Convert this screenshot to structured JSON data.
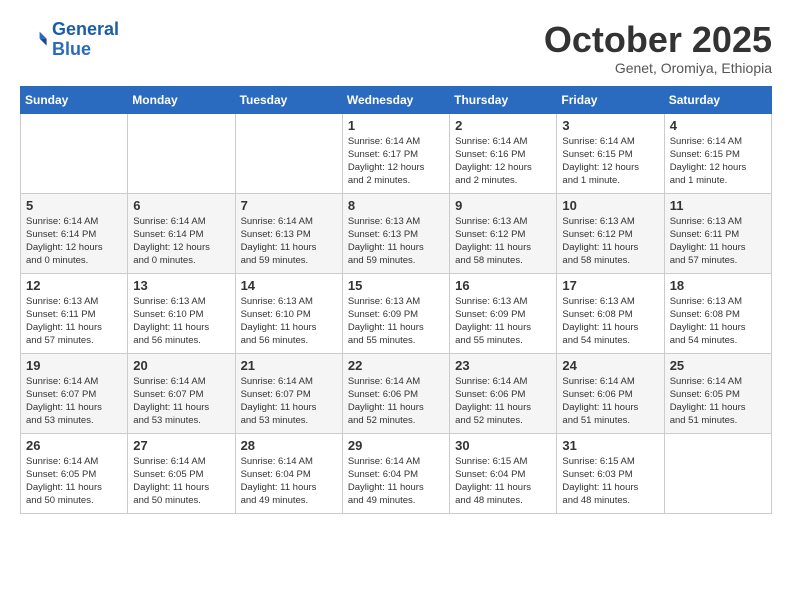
{
  "logo": {
    "line1": "General",
    "line2": "Blue"
  },
  "title": "October 2025",
  "subtitle": "Genet, Oromiya, Ethiopia",
  "days_of_week": [
    "Sunday",
    "Monday",
    "Tuesday",
    "Wednesday",
    "Thursday",
    "Friday",
    "Saturday"
  ],
  "weeks": [
    [
      {
        "day": "",
        "info": ""
      },
      {
        "day": "",
        "info": ""
      },
      {
        "day": "",
        "info": ""
      },
      {
        "day": "1",
        "info": "Sunrise: 6:14 AM\nSunset: 6:17 PM\nDaylight: 12 hours\nand 2 minutes."
      },
      {
        "day": "2",
        "info": "Sunrise: 6:14 AM\nSunset: 6:16 PM\nDaylight: 12 hours\nand 2 minutes."
      },
      {
        "day": "3",
        "info": "Sunrise: 6:14 AM\nSunset: 6:15 PM\nDaylight: 12 hours\nand 1 minute."
      },
      {
        "day": "4",
        "info": "Sunrise: 6:14 AM\nSunset: 6:15 PM\nDaylight: 12 hours\nand 1 minute."
      }
    ],
    [
      {
        "day": "5",
        "info": "Sunrise: 6:14 AM\nSunset: 6:14 PM\nDaylight: 12 hours\nand 0 minutes."
      },
      {
        "day": "6",
        "info": "Sunrise: 6:14 AM\nSunset: 6:14 PM\nDaylight: 12 hours\nand 0 minutes."
      },
      {
        "day": "7",
        "info": "Sunrise: 6:14 AM\nSunset: 6:13 PM\nDaylight: 11 hours\nand 59 minutes."
      },
      {
        "day": "8",
        "info": "Sunrise: 6:13 AM\nSunset: 6:13 PM\nDaylight: 11 hours\nand 59 minutes."
      },
      {
        "day": "9",
        "info": "Sunrise: 6:13 AM\nSunset: 6:12 PM\nDaylight: 11 hours\nand 58 minutes."
      },
      {
        "day": "10",
        "info": "Sunrise: 6:13 AM\nSunset: 6:12 PM\nDaylight: 11 hours\nand 58 minutes."
      },
      {
        "day": "11",
        "info": "Sunrise: 6:13 AM\nSunset: 6:11 PM\nDaylight: 11 hours\nand 57 minutes."
      }
    ],
    [
      {
        "day": "12",
        "info": "Sunrise: 6:13 AM\nSunset: 6:11 PM\nDaylight: 11 hours\nand 57 minutes."
      },
      {
        "day": "13",
        "info": "Sunrise: 6:13 AM\nSunset: 6:10 PM\nDaylight: 11 hours\nand 56 minutes."
      },
      {
        "day": "14",
        "info": "Sunrise: 6:13 AM\nSunset: 6:10 PM\nDaylight: 11 hours\nand 56 minutes."
      },
      {
        "day": "15",
        "info": "Sunrise: 6:13 AM\nSunset: 6:09 PM\nDaylight: 11 hours\nand 55 minutes."
      },
      {
        "day": "16",
        "info": "Sunrise: 6:13 AM\nSunset: 6:09 PM\nDaylight: 11 hours\nand 55 minutes."
      },
      {
        "day": "17",
        "info": "Sunrise: 6:13 AM\nSunset: 6:08 PM\nDaylight: 11 hours\nand 54 minutes."
      },
      {
        "day": "18",
        "info": "Sunrise: 6:13 AM\nSunset: 6:08 PM\nDaylight: 11 hours\nand 54 minutes."
      }
    ],
    [
      {
        "day": "19",
        "info": "Sunrise: 6:14 AM\nSunset: 6:07 PM\nDaylight: 11 hours\nand 53 minutes."
      },
      {
        "day": "20",
        "info": "Sunrise: 6:14 AM\nSunset: 6:07 PM\nDaylight: 11 hours\nand 53 minutes."
      },
      {
        "day": "21",
        "info": "Sunrise: 6:14 AM\nSunset: 6:07 PM\nDaylight: 11 hours\nand 53 minutes."
      },
      {
        "day": "22",
        "info": "Sunrise: 6:14 AM\nSunset: 6:06 PM\nDaylight: 11 hours\nand 52 minutes."
      },
      {
        "day": "23",
        "info": "Sunrise: 6:14 AM\nSunset: 6:06 PM\nDaylight: 11 hours\nand 52 minutes."
      },
      {
        "day": "24",
        "info": "Sunrise: 6:14 AM\nSunset: 6:06 PM\nDaylight: 11 hours\nand 51 minutes."
      },
      {
        "day": "25",
        "info": "Sunrise: 6:14 AM\nSunset: 6:05 PM\nDaylight: 11 hours\nand 51 minutes."
      }
    ],
    [
      {
        "day": "26",
        "info": "Sunrise: 6:14 AM\nSunset: 6:05 PM\nDaylight: 11 hours\nand 50 minutes."
      },
      {
        "day": "27",
        "info": "Sunrise: 6:14 AM\nSunset: 6:05 PM\nDaylight: 11 hours\nand 50 minutes."
      },
      {
        "day": "28",
        "info": "Sunrise: 6:14 AM\nSunset: 6:04 PM\nDaylight: 11 hours\nand 49 minutes."
      },
      {
        "day": "29",
        "info": "Sunrise: 6:14 AM\nSunset: 6:04 PM\nDaylight: 11 hours\nand 49 minutes."
      },
      {
        "day": "30",
        "info": "Sunrise: 6:15 AM\nSunset: 6:04 PM\nDaylight: 11 hours\nand 48 minutes."
      },
      {
        "day": "31",
        "info": "Sunrise: 6:15 AM\nSunset: 6:03 PM\nDaylight: 11 hours\nand 48 minutes."
      },
      {
        "day": "",
        "info": ""
      }
    ]
  ]
}
